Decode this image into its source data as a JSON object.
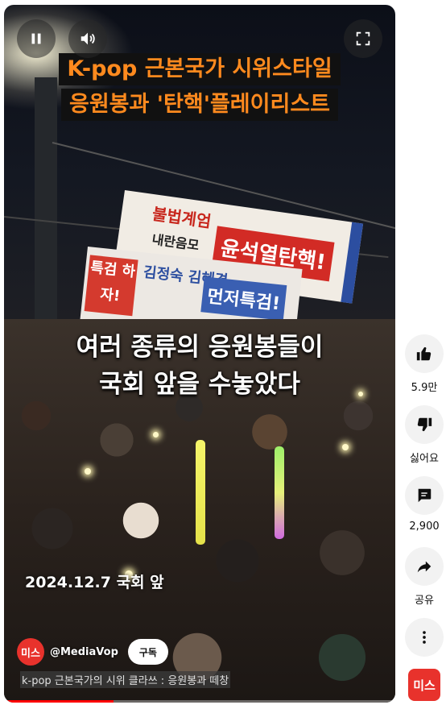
{
  "video": {
    "title_line1": "K-pop 근본국가 시위스타일",
    "title_line2": "응원봉과 '탄핵'플레이리스트",
    "caption_line1": "여러 종류의 응원봉들이",
    "caption_line2": "국회 앞을 수놓았다",
    "date_text": "2024.12.7 국회 앞",
    "banner1": {
      "top": "불법계엄",
      "middle": "내란음모",
      "red": "윤석열탄핵!"
    },
    "banner2": {
      "red": "특검 하자!",
      "names": "김정숙 김혜경",
      "blue": "먼저특검!"
    },
    "progress_fraction": 0.28
  },
  "channel": {
    "avatar_text": "미스",
    "handle": "@MediaVop",
    "subscribe_label": "구독"
  },
  "video_title": "k-pop 근본국가의 시위 클라쓰 : 응원봉과 떼창",
  "actions": {
    "like_count": "5.9만",
    "dislike_label": "싫어요",
    "comment_count": "2,900",
    "share_label": "공유"
  },
  "colors": {
    "accent": "#ff0000",
    "title_orange": "#ff8a1e",
    "brand_red": "#e8322c"
  }
}
